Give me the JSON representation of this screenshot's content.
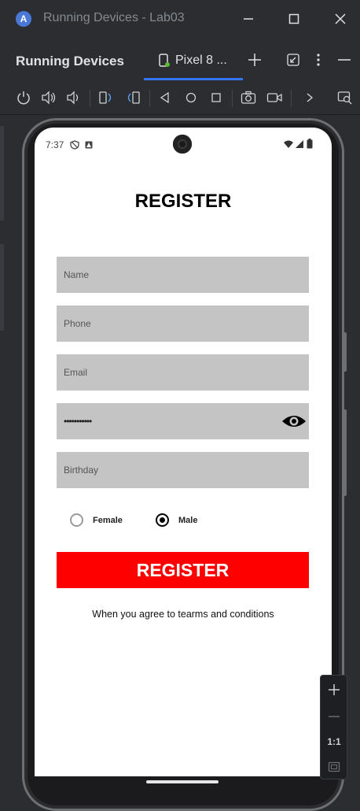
{
  "window": {
    "title": "Running Devices - Lab03",
    "app_icon_letter": "A"
  },
  "tool_window": {
    "title": "Running Devices",
    "device_tab_label": "Pixel 8 ...",
    "device_status_color": "#5fb832"
  },
  "phone": {
    "status_time": "7:37",
    "register_title": "REGISTER",
    "fields": {
      "name_placeholder": "Name",
      "phone_placeholder": "Phone",
      "email_placeholder": "Email",
      "password_value": "•••••••••••",
      "birthday_placeholder": "Birthday"
    },
    "gender": {
      "female_label": "Female",
      "male_label": "Male",
      "selected": "Male"
    },
    "register_button": "REGISTER",
    "terms_text": "When you agree to tearms and conditions",
    "register_button_color": "#ff0000",
    "field_background": "#c4c4c4"
  },
  "zoom": {
    "one_to_one_label": "1:1"
  }
}
